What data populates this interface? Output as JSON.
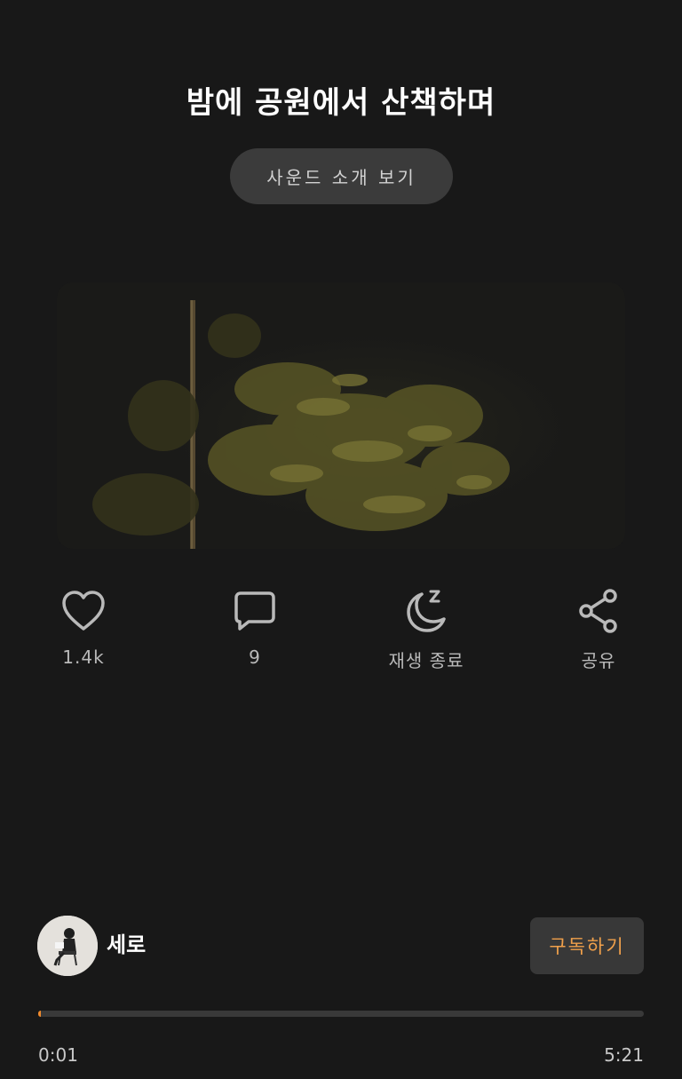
{
  "header": {
    "title": "밤에 공원에서 산책하며",
    "intro_button": "사운드 소개 보기"
  },
  "actions": {
    "like": {
      "icon": "heart-icon",
      "label": "1.4k"
    },
    "comment": {
      "icon": "comment-icon",
      "label": "9"
    },
    "sleep_timer": {
      "icon": "moon-sleep-icon",
      "label": "재생 종료"
    },
    "share": {
      "icon": "share-icon",
      "label": "공유"
    }
  },
  "creator": {
    "name": "세로",
    "subscribe_label": "구독하기"
  },
  "player": {
    "current_time": "0:01",
    "total_time": "5:21",
    "progress": 0.003
  },
  "colors": {
    "background": "#181818",
    "accent": "#f08a2c",
    "subscribe_text": "#f0a04b",
    "button_bg": "#3b3b3b"
  }
}
